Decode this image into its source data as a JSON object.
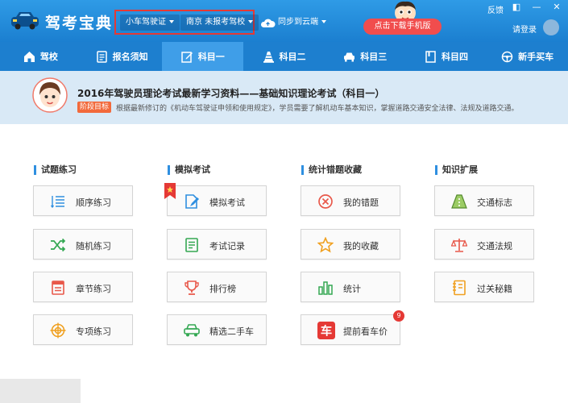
{
  "app": {
    "title": "驾考宝典",
    "license_selector": "小车驾驶证",
    "school_selector": "南京 未报考驾校",
    "sync_label": "同步到云端",
    "download_label": "点击下载手机版",
    "feedback_label": "反馈",
    "login_label": "请登录",
    "window_controls": [
      "◧",
      "—",
      "✕"
    ]
  },
  "nav": {
    "items": [
      {
        "label": "驾校",
        "icon": "home-icon"
      },
      {
        "label": "报名须知",
        "icon": "document-icon"
      },
      {
        "label": "科目一",
        "icon": "edit-icon",
        "active": true
      },
      {
        "label": "科目二",
        "icon": "cone-icon"
      },
      {
        "label": "科目三",
        "icon": "car-icon"
      },
      {
        "label": "科目四",
        "icon": "book-icon"
      },
      {
        "label": "新手买车",
        "icon": "steering-wheel-icon"
      }
    ]
  },
  "banner": {
    "title": "2016年驾驶员理论考试最新学习资料——基础知识理论考试（科目一）",
    "tag": "阶段目标",
    "description": "根据最新修订的《机动车驾驶证申领和使用规定》，学员需要了解机动车基本知识，掌握道路交通安全法律、法规及道路交通。"
  },
  "sections": [
    {
      "title": "试题练习",
      "cards": [
        {
          "label": "顺序练习",
          "icon": "list-icon"
        },
        {
          "label": "随机练习",
          "icon": "shuffle-icon"
        },
        {
          "label": "章节练习",
          "icon": "chapter-icon"
        },
        {
          "label": "专项练习",
          "icon": "target-icon"
        }
      ]
    },
    {
      "title": "模拟考试",
      "cards": [
        {
          "label": "模拟考试",
          "icon": "exam-icon"
        },
        {
          "label": "考试记录",
          "icon": "record-icon"
        },
        {
          "label": "排行榜",
          "icon": "trophy-icon"
        },
        {
          "label": "精选二手车",
          "icon": "used-car-icon"
        }
      ]
    },
    {
      "title": "统计错题收藏",
      "cards": [
        {
          "label": "我的错题",
          "icon": "wrong-icon"
        },
        {
          "label": "我的收藏",
          "icon": "star-icon"
        },
        {
          "label": "统计",
          "icon": "bar-chart-icon"
        },
        {
          "label": "提前看车价",
          "icon": "car-price-icon",
          "badge": "9"
        }
      ]
    },
    {
      "title": "知识扩展",
      "cards": [
        {
          "label": "交通标志",
          "icon": "road-sign-icon"
        },
        {
          "label": "交通法规",
          "icon": "scales-icon"
        },
        {
          "label": "过关秘籍",
          "icon": "notebook-icon"
        }
      ]
    }
  ],
  "colors": {
    "top_bar": "#1b7fd0",
    "nav_active": "#3f9ee8",
    "banner_bg": "#d9e9f6",
    "accent_red": "#e53935",
    "tag_orange": "#f26a3c"
  }
}
